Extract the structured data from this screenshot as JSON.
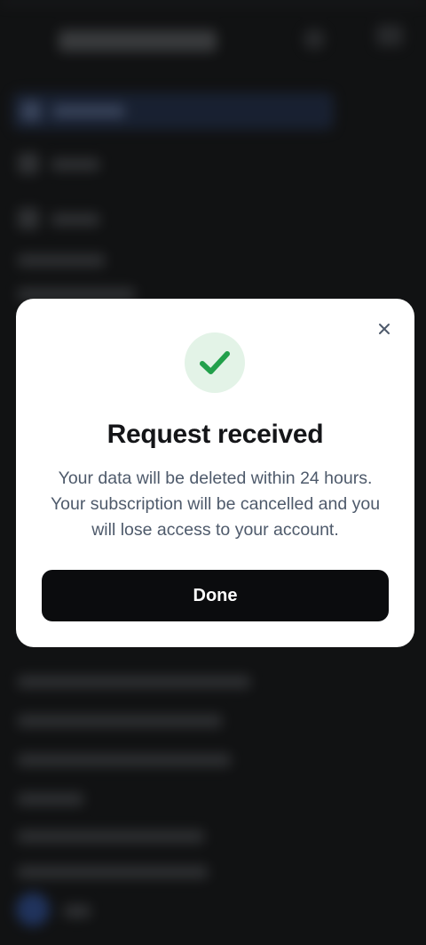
{
  "modal": {
    "title": "Request received",
    "message": "Your data will be deleted within 24 hours. Your subscription will be cancelled and you will lose access to your account.",
    "done_label": "Done",
    "close_icon": "close-icon",
    "status_icon": "checkmark-icon"
  },
  "colors": {
    "success_green": "#22a04b",
    "success_bg": "#e3f3e7",
    "button_bg": "#0b0c0e",
    "overlay": "#111213"
  }
}
